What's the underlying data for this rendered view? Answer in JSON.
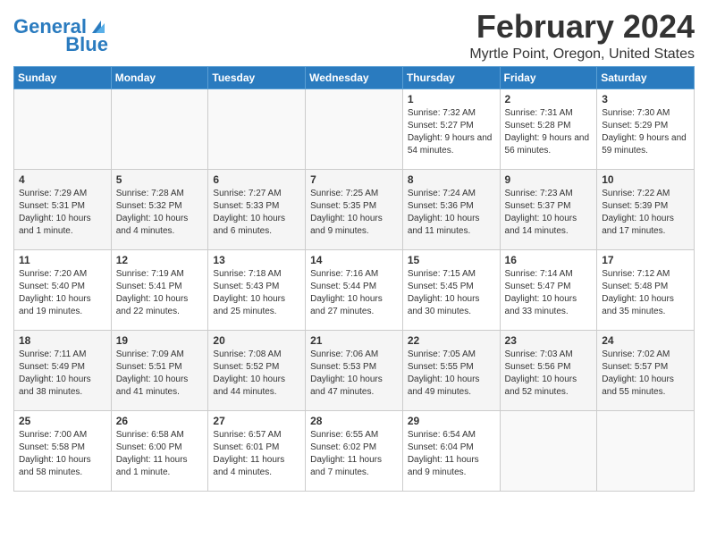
{
  "logo": {
    "line1": "General",
    "line2": "Blue"
  },
  "title": "February 2024",
  "subtitle": "Myrtle Point, Oregon, United States",
  "days_of_week": [
    "Sunday",
    "Monday",
    "Tuesday",
    "Wednesday",
    "Thursday",
    "Friday",
    "Saturday"
  ],
  "weeks": [
    [
      {
        "day": "",
        "info": ""
      },
      {
        "day": "",
        "info": ""
      },
      {
        "day": "",
        "info": ""
      },
      {
        "day": "",
        "info": ""
      },
      {
        "day": "1",
        "info": "Sunrise: 7:32 AM\nSunset: 5:27 PM\nDaylight: 9 hours and 54 minutes."
      },
      {
        "day": "2",
        "info": "Sunrise: 7:31 AM\nSunset: 5:28 PM\nDaylight: 9 hours and 56 minutes."
      },
      {
        "day": "3",
        "info": "Sunrise: 7:30 AM\nSunset: 5:29 PM\nDaylight: 9 hours and 59 minutes."
      }
    ],
    [
      {
        "day": "4",
        "info": "Sunrise: 7:29 AM\nSunset: 5:31 PM\nDaylight: 10 hours and 1 minute."
      },
      {
        "day": "5",
        "info": "Sunrise: 7:28 AM\nSunset: 5:32 PM\nDaylight: 10 hours and 4 minutes."
      },
      {
        "day": "6",
        "info": "Sunrise: 7:27 AM\nSunset: 5:33 PM\nDaylight: 10 hours and 6 minutes."
      },
      {
        "day": "7",
        "info": "Sunrise: 7:25 AM\nSunset: 5:35 PM\nDaylight: 10 hours and 9 minutes."
      },
      {
        "day": "8",
        "info": "Sunrise: 7:24 AM\nSunset: 5:36 PM\nDaylight: 10 hours and 11 minutes."
      },
      {
        "day": "9",
        "info": "Sunrise: 7:23 AM\nSunset: 5:37 PM\nDaylight: 10 hours and 14 minutes."
      },
      {
        "day": "10",
        "info": "Sunrise: 7:22 AM\nSunset: 5:39 PM\nDaylight: 10 hours and 17 minutes."
      }
    ],
    [
      {
        "day": "11",
        "info": "Sunrise: 7:20 AM\nSunset: 5:40 PM\nDaylight: 10 hours and 19 minutes."
      },
      {
        "day": "12",
        "info": "Sunrise: 7:19 AM\nSunset: 5:41 PM\nDaylight: 10 hours and 22 minutes."
      },
      {
        "day": "13",
        "info": "Sunrise: 7:18 AM\nSunset: 5:43 PM\nDaylight: 10 hours and 25 minutes."
      },
      {
        "day": "14",
        "info": "Sunrise: 7:16 AM\nSunset: 5:44 PM\nDaylight: 10 hours and 27 minutes."
      },
      {
        "day": "15",
        "info": "Sunrise: 7:15 AM\nSunset: 5:45 PM\nDaylight: 10 hours and 30 minutes."
      },
      {
        "day": "16",
        "info": "Sunrise: 7:14 AM\nSunset: 5:47 PM\nDaylight: 10 hours and 33 minutes."
      },
      {
        "day": "17",
        "info": "Sunrise: 7:12 AM\nSunset: 5:48 PM\nDaylight: 10 hours and 35 minutes."
      }
    ],
    [
      {
        "day": "18",
        "info": "Sunrise: 7:11 AM\nSunset: 5:49 PM\nDaylight: 10 hours and 38 minutes."
      },
      {
        "day": "19",
        "info": "Sunrise: 7:09 AM\nSunset: 5:51 PM\nDaylight: 10 hours and 41 minutes."
      },
      {
        "day": "20",
        "info": "Sunrise: 7:08 AM\nSunset: 5:52 PM\nDaylight: 10 hours and 44 minutes."
      },
      {
        "day": "21",
        "info": "Sunrise: 7:06 AM\nSunset: 5:53 PM\nDaylight: 10 hours and 47 minutes."
      },
      {
        "day": "22",
        "info": "Sunrise: 7:05 AM\nSunset: 5:55 PM\nDaylight: 10 hours and 49 minutes."
      },
      {
        "day": "23",
        "info": "Sunrise: 7:03 AM\nSunset: 5:56 PM\nDaylight: 10 hours and 52 minutes."
      },
      {
        "day": "24",
        "info": "Sunrise: 7:02 AM\nSunset: 5:57 PM\nDaylight: 10 hours and 55 minutes."
      }
    ],
    [
      {
        "day": "25",
        "info": "Sunrise: 7:00 AM\nSunset: 5:58 PM\nDaylight: 10 hours and 58 minutes."
      },
      {
        "day": "26",
        "info": "Sunrise: 6:58 AM\nSunset: 6:00 PM\nDaylight: 11 hours and 1 minute."
      },
      {
        "day": "27",
        "info": "Sunrise: 6:57 AM\nSunset: 6:01 PM\nDaylight: 11 hours and 4 minutes."
      },
      {
        "day": "28",
        "info": "Sunrise: 6:55 AM\nSunset: 6:02 PM\nDaylight: 11 hours and 7 minutes."
      },
      {
        "day": "29",
        "info": "Sunrise: 6:54 AM\nSunset: 6:04 PM\nDaylight: 11 hours and 9 minutes."
      },
      {
        "day": "",
        "info": ""
      },
      {
        "day": "",
        "info": ""
      }
    ]
  ]
}
